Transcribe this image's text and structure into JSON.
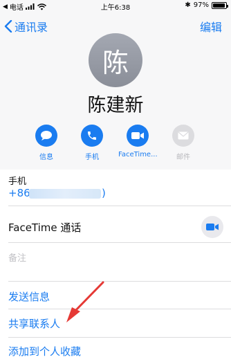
{
  "status_bar": {
    "carrier": "电话",
    "time": "上午6:38",
    "battery": "97%",
    "battery_level": 0.97
  },
  "nav": {
    "back_label": "通讯录",
    "edit_label": "编辑"
  },
  "contact": {
    "avatar_char": "陈",
    "name": "陈建新"
  },
  "actions": [
    {
      "label": "信息",
      "icon": "message-icon",
      "enabled": true
    },
    {
      "label": "手机",
      "icon": "phone-icon",
      "enabled": true
    },
    {
      "label": "FaceTime...",
      "icon": "video-icon",
      "enabled": true
    },
    {
      "label": "邮件",
      "icon": "mail-icon",
      "enabled": false
    }
  ],
  "phone": {
    "label": "手机",
    "prefix": "+86",
    "suffix": ")"
  },
  "facetime": {
    "label": "FaceTime 通话"
  },
  "notes": {
    "placeholder": "备注"
  },
  "links": {
    "send_message": "发送信息",
    "share_contact": "共享联系人",
    "add_favorite": "添加到个人收藏"
  },
  "colors": {
    "accent": "#1a7cf0",
    "annotation_arrow": "#e53935"
  }
}
